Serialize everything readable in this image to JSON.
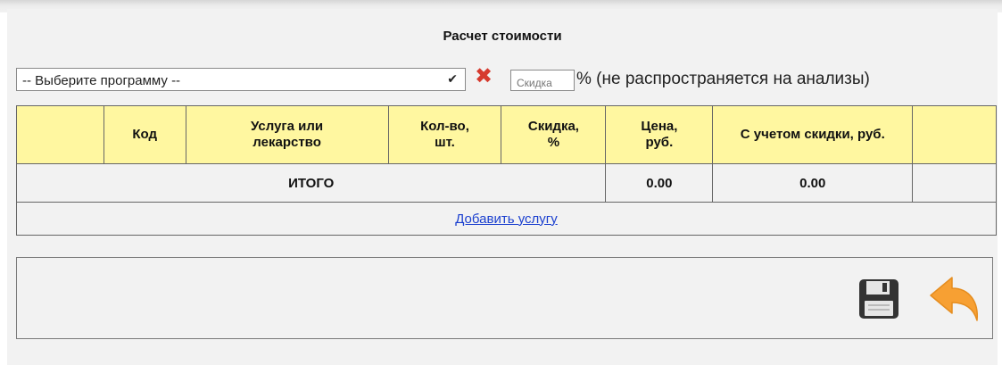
{
  "title": "Расчет стоимости",
  "program_select": {
    "value": "-- Выберите программу --",
    "chevron_icon": "chevron-down-icon"
  },
  "clear_icon": "close-icon",
  "discount": {
    "placeholder": "Скидка",
    "note": "% (не распространяется на анализы)"
  },
  "table": {
    "headers": [
      "",
      "Код",
      "Услуга или лекарство",
      "Кол-во, шт.",
      "Скидка, %",
      "Цена, руб.",
      "С учетом скидки, руб.",
      ""
    ],
    "total_label": "ИТОГО",
    "total_price": "0.00",
    "total_discounted": "0.00",
    "add_link": "Добавить услугу"
  },
  "footer": {
    "save_icon": "save-icon",
    "back_icon": "undo-arrow-icon"
  },
  "colors": {
    "header_bg": "#fff7a0",
    "clear_icon": "#d63a2e",
    "back_icon": "#f7a033",
    "link": "#1a3fcf"
  }
}
